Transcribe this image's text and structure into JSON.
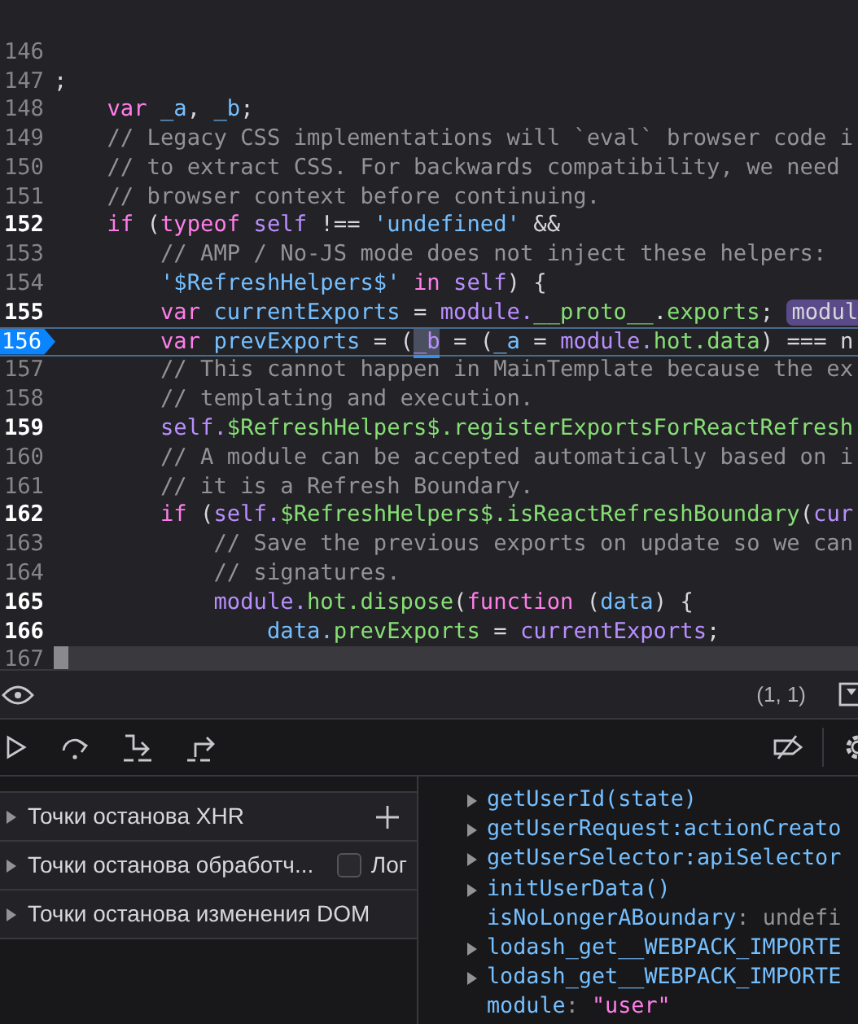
{
  "editor": {
    "lines": [
      {
        "number": "146",
        "breakable": false
      },
      {
        "number": "147",
        "breakable": false,
        "tokens": [
          {
            "kind": "plain",
            "text": ";"
          }
        ]
      },
      {
        "number": "148",
        "breakable": false,
        "tokens": [
          {
            "kind": "kw",
            "text": "    var "
          },
          {
            "kind": "id",
            "text": "_a"
          },
          {
            "kind": "plain",
            "text": ", "
          },
          {
            "kind": "id",
            "text": "_b"
          },
          {
            "kind": "plain",
            "text": ";"
          }
        ]
      },
      {
        "number": "149",
        "breakable": false,
        "tokens": [
          {
            "kind": "cm",
            "text": "    // Legacy CSS implementations will `eval` browser code i"
          }
        ]
      },
      {
        "number": "150",
        "breakable": false,
        "tokens": [
          {
            "kind": "cm",
            "text": "    // to extract CSS. For backwards compatibility, we need"
          }
        ]
      },
      {
        "number": "151",
        "breakable": false,
        "tokens": [
          {
            "kind": "cm",
            "text": "    // browser context before continuing."
          }
        ]
      },
      {
        "number": "152",
        "breakable": true,
        "tokens": [
          {
            "kind": "kw",
            "text": "    if"
          },
          {
            "kind": "plain",
            "text": " ("
          },
          {
            "kind": "kw",
            "text": "typeof "
          },
          {
            "kind": "obj",
            "text": "self"
          },
          {
            "kind": "plain",
            "text": " !== "
          },
          {
            "kind": "id",
            "text": "'undefined'"
          },
          {
            "kind": "plain",
            "text": " &&"
          }
        ]
      },
      {
        "number": "153",
        "breakable": false,
        "tokens": [
          {
            "kind": "cm",
            "text": "        // AMP / No-JS mode does not inject these helpers:"
          }
        ]
      },
      {
        "number": "154",
        "breakable": false,
        "tokens": [
          {
            "kind": "id",
            "text": "        '$RefreshHelpers$'"
          },
          {
            "kind": "kw",
            "text": " in "
          },
          {
            "kind": "obj",
            "text": "self"
          },
          {
            "kind": "plain",
            "text": ") {"
          }
        ]
      },
      {
        "number": "155",
        "breakable": true,
        "tokens": [
          {
            "kind": "kw",
            "text": "        var "
          },
          {
            "kind": "id",
            "text": "currentExports"
          },
          {
            "kind": "plain",
            "text": " = "
          },
          {
            "kind": "obj",
            "text": "module."
          },
          {
            "kind": "prop",
            "text": "__proto__"
          },
          {
            "kind": "plain",
            "text": "."
          },
          {
            "kind": "prop",
            "text": "exports"
          },
          {
            "kind": "plain",
            "text": "; "
          },
          {
            "kind": "badge",
            "text": "modul"
          }
        ]
      },
      {
        "number": "156",
        "current": true,
        "tokens": [
          {
            "kind": "kw",
            "text": "        var "
          },
          {
            "kind": "id",
            "text": "prevExports"
          },
          {
            "kind": "plain",
            "text": " = ("
          },
          {
            "kind": "match",
            "text": "_b"
          },
          {
            "kind": "plain",
            "text": " = ("
          },
          {
            "kind": "id",
            "text": "_a"
          },
          {
            "kind": "plain",
            "text": " = "
          },
          {
            "kind": "obj",
            "text": "module."
          },
          {
            "kind": "prop",
            "text": "hot.data"
          },
          {
            "kind": "plain",
            "text": ") === n"
          }
        ]
      },
      {
        "number": "157",
        "breakable": false,
        "tokens": [
          {
            "kind": "cm",
            "text": "        // This cannot happen in MainTemplate because the ex"
          }
        ]
      },
      {
        "number": "158",
        "breakable": false,
        "tokens": [
          {
            "kind": "cm",
            "text": "        // templating and execution."
          }
        ]
      },
      {
        "number": "159",
        "breakable": true,
        "tokens": [
          {
            "kind": "obj",
            "text": "        self."
          },
          {
            "kind": "prop",
            "text": "$RefreshHelpers$.registerExportsForReactRefresh"
          }
        ]
      },
      {
        "number": "160",
        "breakable": false,
        "tokens": [
          {
            "kind": "cm",
            "text": "        // A module can be accepted automatically based on i"
          }
        ]
      },
      {
        "number": "161",
        "breakable": false,
        "tokens": [
          {
            "kind": "cm",
            "text": "        // it is a Refresh Boundary."
          }
        ]
      },
      {
        "number": "162",
        "breakable": true,
        "tokens": [
          {
            "kind": "kw",
            "text": "        if"
          },
          {
            "kind": "plain",
            "text": " ("
          },
          {
            "kind": "obj",
            "text": "self."
          },
          {
            "kind": "prop",
            "text": "$RefreshHelpers$.isReactRefreshBoundary"
          },
          {
            "kind": "plain",
            "text": "("
          },
          {
            "kind": "obj",
            "text": "cur"
          }
        ]
      },
      {
        "number": "163",
        "breakable": false,
        "tokens": [
          {
            "kind": "cm",
            "text": "            // Save the previous exports on update so we can"
          }
        ]
      },
      {
        "number": "164",
        "breakable": false,
        "tokens": [
          {
            "kind": "cm",
            "text": "            // signatures."
          }
        ]
      },
      {
        "number": "165",
        "breakable": true,
        "tokens": [
          {
            "kind": "obj",
            "text": "            module."
          },
          {
            "kind": "prop",
            "text": "hot.dispose"
          },
          {
            "kind": "plain",
            "text": "("
          },
          {
            "kind": "kw",
            "text": "function"
          },
          {
            "kind": "plain",
            "text": " ("
          },
          {
            "kind": "id",
            "text": "data"
          },
          {
            "kind": "plain",
            "text": ") {"
          }
        ]
      },
      {
        "number": "166",
        "breakable": true,
        "tokens": [
          {
            "kind": "id",
            "text": "                data."
          },
          {
            "kind": "prop",
            "text": "prevExports"
          },
          {
            "kind": "plain",
            "text": " = "
          },
          {
            "kind": "obj",
            "text": "currentExports"
          },
          {
            "kind": "plain",
            "text": ";"
          }
        ]
      },
      {
        "number": "167",
        "breakable": false,
        "cursor": true
      }
    ]
  },
  "status_bar": {
    "position": "(1, 1)"
  },
  "breakpoint_panels": [
    {
      "label": "Точки останова XHR",
      "kind": "add"
    },
    {
      "label": "Точки останова обработч...",
      "kind": "checkbox",
      "checkbox_label": "Лог",
      "checked": false
    },
    {
      "label": "Точки останова изменения DOM",
      "kind": "plain"
    }
  ],
  "scopes": [
    {
      "name": "getUserId(state)",
      "expandable": true
    },
    {
      "name": "getUserRequest:actionCreato",
      "expandable": true
    },
    {
      "name": "getUserSelector:apiSelector",
      "expandable": true
    },
    {
      "name": "initUserData()",
      "expandable": true
    },
    {
      "name": "isNoLongerABoundary",
      "expandable": false,
      "separator": ":",
      "value": "undefi",
      "kind": "undefined"
    },
    {
      "name": "lodash_get__WEBPACK_IMPORTE",
      "expandable": true
    },
    {
      "name": "lodash_get__WEBPACK_IMPORTE",
      "expandable": true
    },
    {
      "name": "module",
      "expandable": false,
      "separator": ":",
      "value": "\"user\"",
      "kind": "string"
    }
  ]
}
